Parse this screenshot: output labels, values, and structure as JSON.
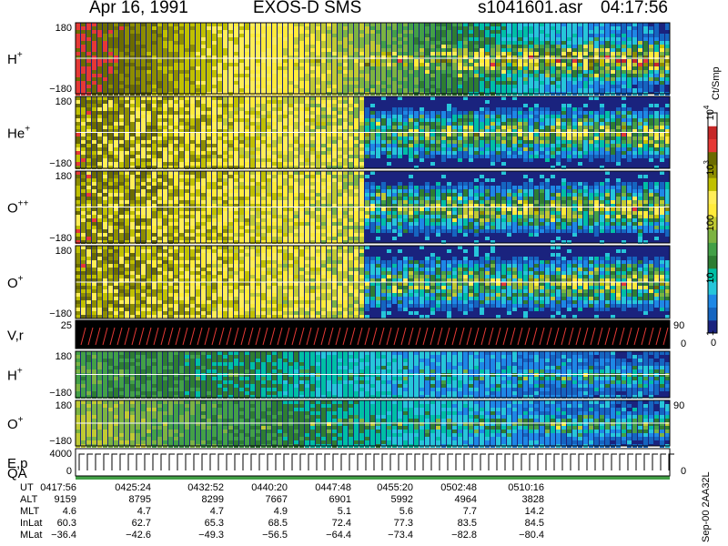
{
  "header": {
    "date": "Apr 16, 1991",
    "instrument": "EXOS-D SMS",
    "filename": "s1041601.asr",
    "time": "04:17:56"
  },
  "colorbar": {
    "unit": "Ct/Smp",
    "ticks": [
      {
        "label": "1",
        "value": 1
      },
      {
        "label": "10",
        "value": 10
      },
      {
        "label": "100",
        "value": 100
      },
      {
        "label": "10",
        "sup": "3",
        "value": 1000
      },
      {
        "label": "10",
        "sup": "4",
        "value": 10000
      }
    ],
    "bottom_label": "0",
    "colors": [
      "#1a237e",
      "#1565c0",
      "#1e88e5",
      "#26c6da",
      "#00bfa5",
      "#2e7d32",
      "#43a047",
      "#7cb342",
      "#c0ca33",
      "#ffeb3b",
      "#ffee58",
      "#c0c000",
      "#8d8d00",
      "#6b6b00",
      "#e53935",
      "#c62828",
      "#ffffff"
    ]
  },
  "chart_data": {
    "type": "heatmap",
    "colors": {
      "background": "#1a237e",
      "low": "#1565c0",
      "mid": "#43a047",
      "high": "#ffeb3b",
      "peak": "#e53935",
      "saturated": "#ffffff"
    },
    "panels": [
      {
        "label": "H",
        "sup": "+",
        "ymax": "180",
        "ymin": "−180",
        "onset_fraction": 0.0,
        "intensity": 0.9
      },
      {
        "label": "He",
        "sup": "+",
        "ymax": "180",
        "ymin": "−180",
        "onset_fraction": 0.48,
        "intensity": 0.7
      },
      {
        "label": "O",
        "sup": "++",
        "ymax": "180",
        "ymin": "−180",
        "onset_fraction": 0.48,
        "intensity": 0.7
      },
      {
        "label": "O",
        "sup": "+",
        "ymax": "180",
        "ymin": "−180",
        "onset_fraction": 0.48,
        "intensity": 0.7
      },
      {
        "label": "V,r",
        "sup": "",
        "ymax": "25",
        "ymin": "",
        "right_tick": "90",
        "right_tick_bottom": "0",
        "kind": "line"
      },
      {
        "label": "H",
        "sup": "+",
        "ymax": "180",
        "ymin": "−180",
        "onset_fraction": 0.0,
        "intensity": 0.4
      },
      {
        "label": "O",
        "sup": "+",
        "ymax": "180",
        "ymin": "−180",
        "onset_fraction": 0.0,
        "intensity": 0.5,
        "right_tick": "90"
      },
      {
        "label": "E,p",
        "sup": "",
        "label2": "QA",
        "ymax": "4000",
        "ymin": "0",
        "right_tick_bottom": "0",
        "kind": "sweep"
      }
    ],
    "x": [
      "0417:56",
      "0425:24",
      "0432:52",
      "0440:20",
      "0447:48",
      "0455:20",
      "0502:48",
      "0510:16"
    ]
  },
  "footer": {
    "rows": [
      {
        "label": "UT",
        "values": [
          "0417:56",
          "0425:24",
          "0432:52",
          "0440:20",
          "0447:48",
          "0455:20",
          "0502:48",
          "0510:16"
        ]
      },
      {
        "label": "ALT",
        "values": [
          "9159",
          "8795",
          "8299",
          "7667",
          "6901",
          "5992",
          "4964",
          "3828"
        ]
      },
      {
        "label": "MLT",
        "values": [
          "4.6",
          "4.7",
          "4.7",
          "4.9",
          "5.1",
          "5.6",
          "7.7",
          "14.2"
        ]
      },
      {
        "label": "InLat",
        "values": [
          "60.3",
          "62.7",
          "65.3",
          "68.5",
          "72.4",
          "77.3",
          "83.5",
          "84.5"
        ]
      },
      {
        "label": "MLat",
        "values": [
          "−36.4",
          "−42.6",
          "−49.3",
          "−56.5",
          "−64.4",
          "−73.4",
          "−82.8",
          "−80.4"
        ]
      }
    ],
    "note": "Sep-00 2AA32L"
  }
}
